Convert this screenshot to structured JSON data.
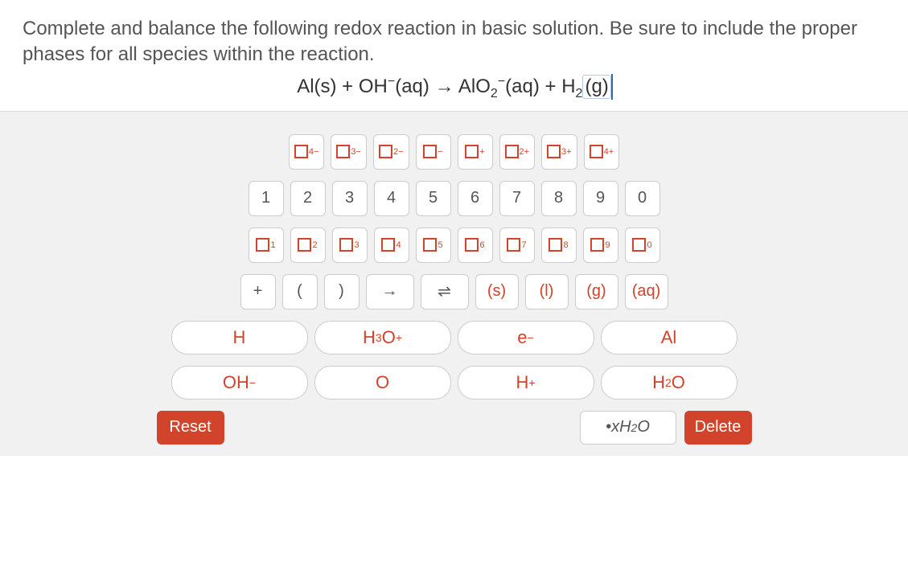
{
  "question": "Complete and balance the following redox reaction in basic solution. Be sure to include the proper phases for all species within the reaction.",
  "equation": {
    "parts": [
      "Al(s) + OH",
      "⁻",
      "(aq) → AlO",
      "₂",
      "⁻",
      "(aq) + H",
      "₂"
    ],
    "cursor_content": "(g)"
  },
  "charges": [
    "4−",
    "3−",
    "2−",
    "−",
    "+",
    "2+",
    "3+",
    "4+"
  ],
  "numbers": [
    "1",
    "2",
    "3",
    "4",
    "5",
    "6",
    "7",
    "8",
    "9",
    "0"
  ],
  "subscripts": [
    "1",
    "2",
    "3",
    "4",
    "5",
    "6",
    "7",
    "8",
    "9",
    "0"
  ],
  "symbols": {
    "plus": "+",
    "lparen": "(",
    "rparen": ")",
    "arrow": "→",
    "equilibrium": "⇌"
  },
  "phases": [
    "(s)",
    "(l)",
    "(g)",
    "(aq)"
  ],
  "species_row1": [
    "H",
    "H₃O⁺",
    "e⁻",
    "Al"
  ],
  "species_row2": [
    "OH⁻",
    "O",
    "H⁺",
    "H₂O"
  ],
  "reset": "Reset",
  "xh2o": "• x H₂O",
  "delete": "Delete"
}
